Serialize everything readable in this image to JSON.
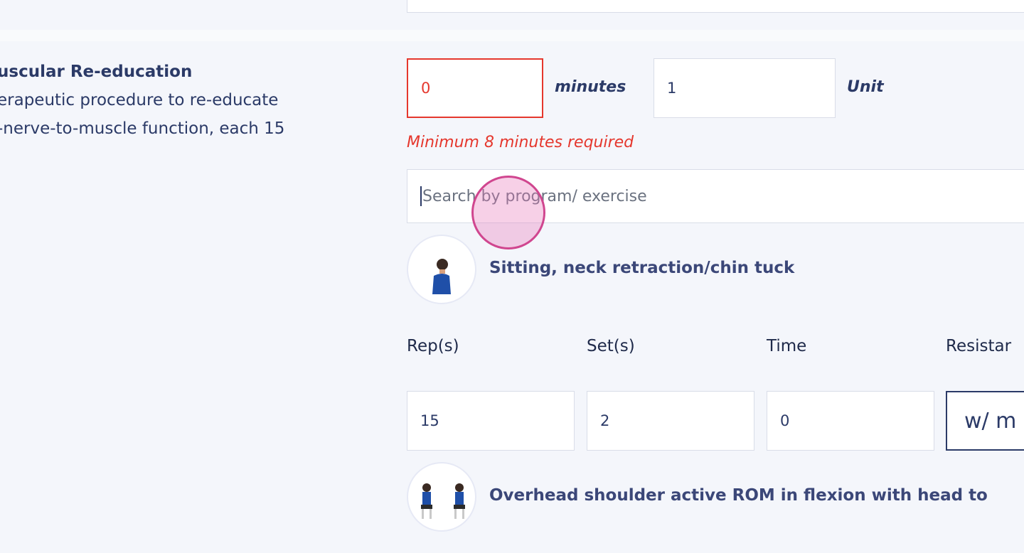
{
  "procedure": {
    "title": "uscular Re-education",
    "desc_lines": [
      "erapeutic procedure to re-educate",
      "-nerve-to-muscle function, each 15"
    ]
  },
  "minutes_field": {
    "value": "0",
    "unit_label": "minutes"
  },
  "unit_field": {
    "value": "1",
    "unit_label": "Unit"
  },
  "error_message": "Minimum 8 minutes required",
  "search": {
    "placeholder": "Search by program/ exercise"
  },
  "exercises": [
    {
      "title": "Sitting, neck retraction/chin tuck",
      "thumb_icon": "person-profile-icon"
    },
    {
      "title": "Overhead shoulder active ROM in flexion with head to",
      "thumb_icon": "two-persons-seated-icon"
    }
  ],
  "params": {
    "labels": [
      "Rep(s)",
      "Set(s)",
      "Time",
      "Resistar"
    ],
    "values": [
      "15",
      "2",
      "0"
    ],
    "resistance_value": "w/ m"
  },
  "colors": {
    "error": "#e5372d",
    "text": "#2b3a67",
    "cursor": "#d0468f"
  }
}
